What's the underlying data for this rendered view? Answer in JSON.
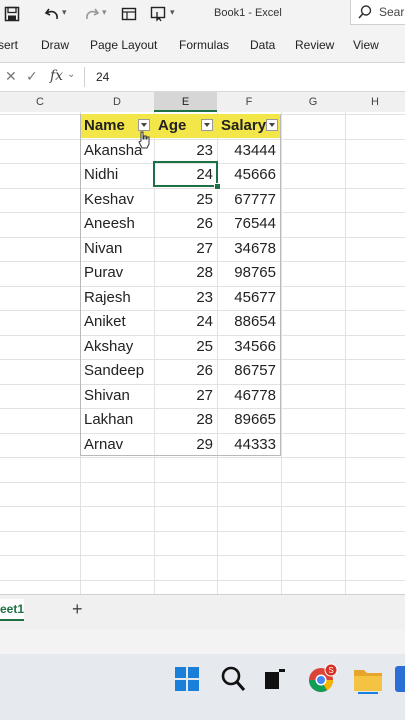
{
  "window": {
    "title": "Book1 - Excel",
    "search_label": "Sear"
  },
  "ribbon": {
    "tabs": [
      "sert",
      "Draw",
      "Page Layout",
      "Formulas",
      "Data",
      "Review",
      "View"
    ]
  },
  "formula_bar": {
    "value": "24"
  },
  "columns": [
    "C",
    "D",
    "E",
    "F",
    "G",
    "H"
  ],
  "selected_column": "E",
  "table": {
    "headers": [
      "Name",
      "Age",
      "Salary"
    ],
    "rows": [
      [
        "Akansha",
        "23",
        "43444"
      ],
      [
        "Nidhi",
        "24",
        "45666"
      ],
      [
        "Keshav",
        "25",
        "67777"
      ],
      [
        "Aneesh",
        "26",
        "76544"
      ],
      [
        "Nivan",
        "27",
        "34678"
      ],
      [
        "Purav",
        "28",
        "98765"
      ],
      [
        "Rajesh",
        "23",
        "45677"
      ],
      [
        "Aniket",
        "24",
        "88654"
      ],
      [
        "Akshay",
        "25",
        "34566"
      ],
      [
        "Sandeep",
        "26",
        "86757"
      ],
      [
        "Shivan",
        "27",
        "46778"
      ],
      [
        "Lakhan",
        "28",
        "89665"
      ],
      [
        "Arnav",
        "29",
        "44333"
      ]
    ]
  },
  "sheet_tabs": {
    "active": "eet1",
    "add_label": "+"
  },
  "colors": {
    "header_fill": "#f2e648",
    "excel_green": "#1e7145",
    "selection": "#1e7145"
  },
  "icons": {
    "titlebar": [
      "save-icon",
      "undo-icon",
      "redo-icon",
      "view-icon",
      "touch-mode-icon"
    ],
    "taskbar": [
      "start-icon",
      "search-icon",
      "task-view-icon",
      "chrome-icon",
      "file-explorer-icon"
    ]
  }
}
